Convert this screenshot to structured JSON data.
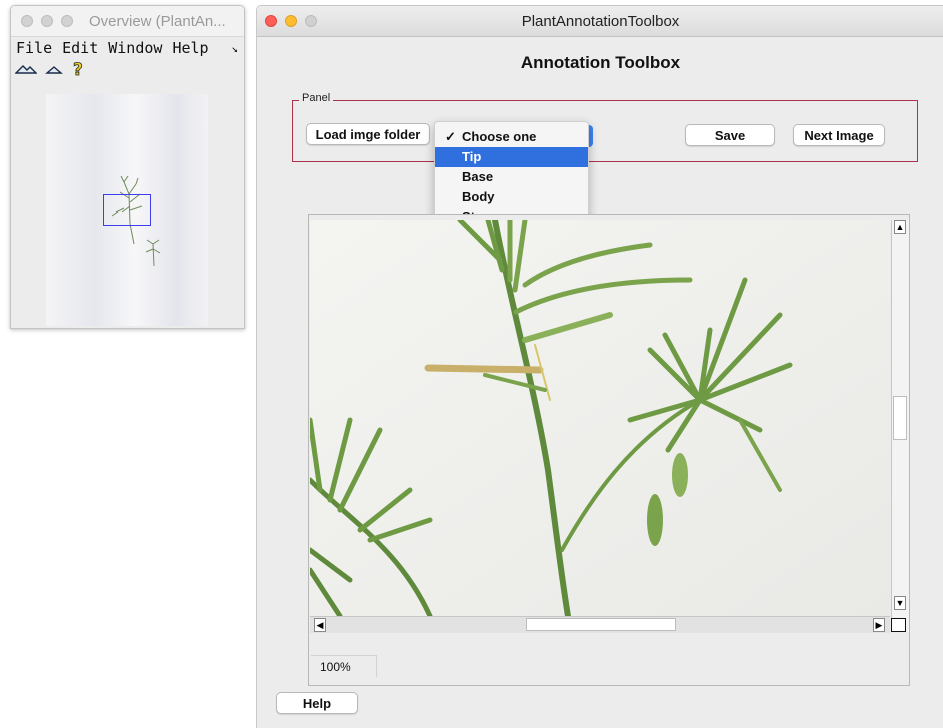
{
  "overview_window": {
    "title": "Overview (PlantAn...",
    "menu": [
      "File",
      "Edit",
      "Window",
      "Help"
    ],
    "menu_overflow_icon": "arrow-icon",
    "toolbar_icons": [
      "mountain-icon",
      "mountain-small-icon",
      "question-icon"
    ]
  },
  "main_window": {
    "title": "PlantAnnotationToolbox",
    "heading": "Annotation Toolbox",
    "panel_label": "Panel",
    "load_button": "Load imge folder",
    "dropdown": {
      "options": [
        "Choose one",
        "Tip",
        "Base",
        "Body",
        "Stem"
      ],
      "checked": "Choose one",
      "highlighted": "Tip"
    },
    "save_button": "Save",
    "next_button": "Next Image",
    "zoom": "100%",
    "help_button": "Help"
  },
  "colors": {
    "panel_border": "#a8334a",
    "highlight": "#2f6fde",
    "close": "#fe5f57",
    "minimize": "#febc2e"
  }
}
